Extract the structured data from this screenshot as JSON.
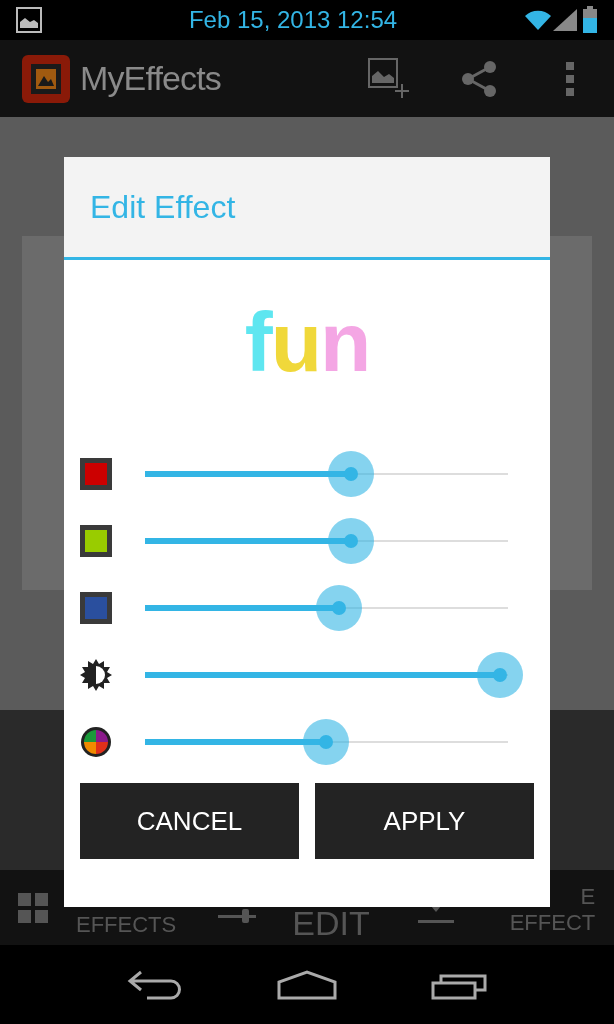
{
  "status_bar": {
    "time": "Feb 15, 2013 12:54"
  },
  "action_bar": {
    "title": "MyEffects"
  },
  "dialog": {
    "title": "Edit Effect",
    "preview": {
      "text": "fun",
      "letters": [
        {
          "color": "#5ee6f0"
        },
        {
          "color": "#f0d83a"
        },
        {
          "color": "#f4a6e4"
        }
      ]
    },
    "sliders": [
      {
        "kind": "swatch",
        "color": "#cc0000",
        "level": 0.567
      },
      {
        "kind": "swatch",
        "color": "#99cc00",
        "level": 0.567
      },
      {
        "kind": "swatch",
        "color": "#2a4f9e",
        "level": 0.534
      },
      {
        "kind": "brightness",
        "level": 0.978
      },
      {
        "kind": "hue",
        "level": 0.499
      }
    ],
    "buttons": [
      "CANCEL",
      "APPLY"
    ]
  },
  "bottom_bar": {
    "items": [
      {
        "kind": "grid",
        "lines": [
          "EFFECTS"
        ]
      },
      {
        "kind": "sliders",
        "lines": [
          "EDIT"
        ]
      },
      {
        "kind": "download",
        "lines": [
          "E",
          "EFFECT"
        ]
      }
    ]
  }
}
